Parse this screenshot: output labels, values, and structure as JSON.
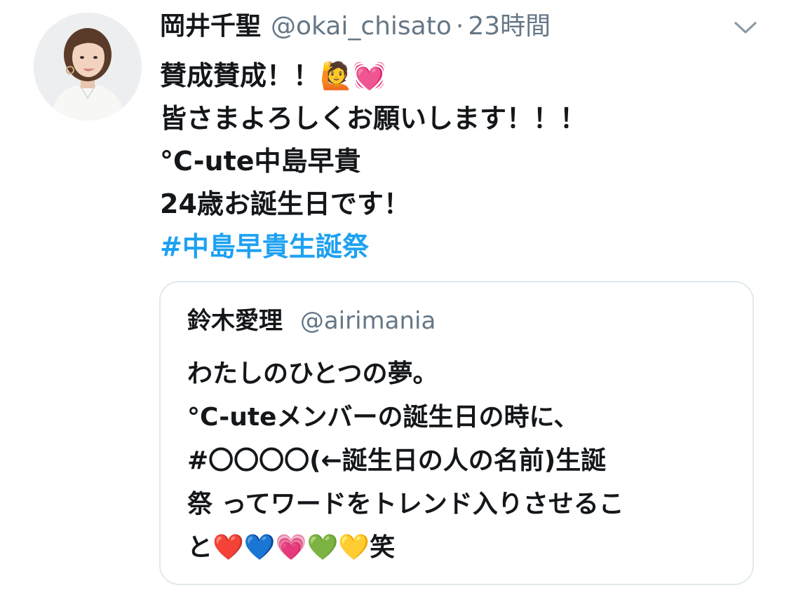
{
  "tweet": {
    "author_name": "岡井千聖",
    "author_handle": "@okai_chisato",
    "separator": "·",
    "time": "23時間",
    "lines": [
      "賛成賛成！！🙋💓",
      "皆さまよろしくお願いします！！！",
      "°C-ute中島早貴",
      "24歳お誕生日です！"
    ],
    "hashtag": "#中島早貴生誕祭"
  },
  "quoted": {
    "author_name": "鈴木愛理",
    "author_handle": "@airimania",
    "lines": [
      "わたしのひとつの夢。",
      "°C-uteメンバーの誕生日の時に、",
      "#〇〇〇〇(←誕生日の人の名前)生誕",
      "祭 ってワードをトレンド入りさせるこ",
      "と❤️💙💗💚💛笑"
    ]
  },
  "icons": {
    "chevron": "chevron-down-icon",
    "avatar": "profile-photo"
  },
  "colors": {
    "text": "#14171a",
    "secondary": "#657786",
    "link": "#1da1f2",
    "border": "#e1e8ed"
  }
}
